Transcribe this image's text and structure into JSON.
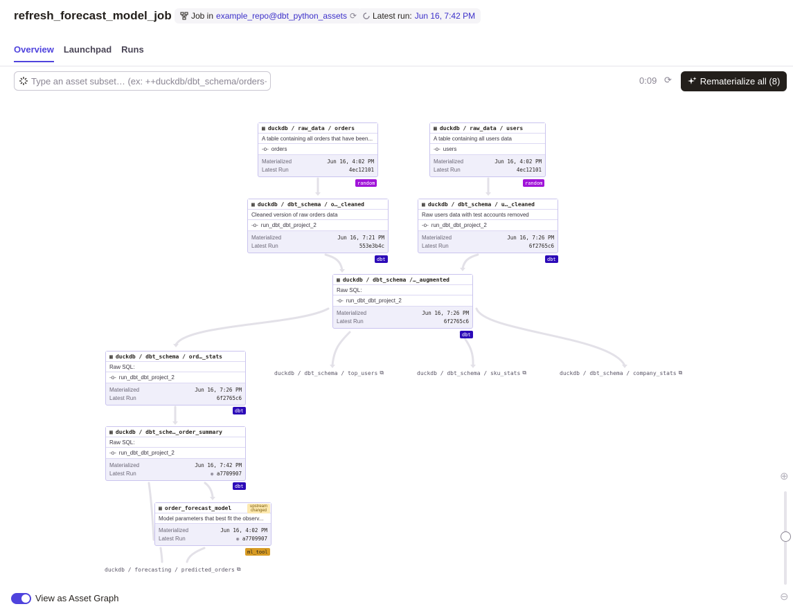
{
  "header": {
    "title": "refresh_forecast_model_job",
    "job_in_label": "Job in",
    "repo": "example_repo@dbt_python_assets",
    "latest_run_label": "Latest run:",
    "latest_run_value": "Jun 16, 7:42 PM"
  },
  "tabs": [
    {
      "label": "Overview",
      "active": true
    },
    {
      "label": "Launchpad",
      "active": false
    },
    {
      "label": "Runs",
      "active": false
    }
  ],
  "toolbar": {
    "search_placeholder": "Type an asset subset… (ex: ++duckdb/dbt_schema/orders+)",
    "timer": "0:09",
    "rematerialize_label": "Rematerialize all (8)"
  },
  "labels": {
    "materialized": "Materialized",
    "latest_run": "Latest Run"
  },
  "nodes": {
    "raw_orders": {
      "title": "duckdb / raw_data / orders",
      "desc": "A table containing all orders that have been...",
      "code": "orders",
      "materialized": "Jun 16, 4:02 PM",
      "latest_run": "4ec12101",
      "kind": "random"
    },
    "raw_users": {
      "title": "duckdb / raw_data / users",
      "desc": "A table containing all users data",
      "code": "users",
      "materialized": "Jun 16, 4:02 PM",
      "latest_run": "4ec12101",
      "kind": "random"
    },
    "orders_cleaned": {
      "title": "duckdb / dbt_schema / o…_cleaned",
      "desc": "Cleaned version of raw orders data",
      "code": "run_dbt_dbt_project_2",
      "materialized": "Jun 16, 7:21 PM",
      "latest_run": "553e3b4c",
      "kind": "dbt"
    },
    "users_cleaned": {
      "title": "duckdb / dbt_schema / u…_cleaned",
      "desc": "Raw users data with test accounts removed",
      "code": "run_dbt_dbt_project_2",
      "materialized": "Jun 16, 7:26 PM",
      "latest_run": "6f2765c6",
      "kind": "dbt"
    },
    "augmented": {
      "title": "duckdb / dbt_schema /…_augmented",
      "desc": "Raw SQL:",
      "code": "run_dbt_dbt_project_2",
      "materialized": "Jun 16, 7:26 PM",
      "latest_run": "6f2765c6",
      "kind": "dbt"
    },
    "order_stats": {
      "title": "duckdb / dbt_schema / ord…_stats",
      "desc": "Raw SQL:",
      "code": "run_dbt_dbt_project_2",
      "materialized": "Jun 16, 7:26 PM",
      "latest_run": "6f2765c6",
      "kind": "dbt"
    },
    "order_summary": {
      "title": "duckdb / dbt_sche…_order_summary",
      "desc": "Raw SQL:",
      "code": "run_dbt_dbt_project_2",
      "materialized": "Jun 16, 7:42 PM",
      "latest_run": "a7709907",
      "kind": "dbt"
    },
    "forecast": {
      "title": "order_forecast_model",
      "desc": "Model parameters that best fit the observ...",
      "badge": "upstream changed",
      "materialized": "Jun 16, 4:02 PM",
      "latest_run": "a7709907",
      "kind": "ml_tool"
    }
  },
  "external_assets": {
    "top_users": "duckdb / dbt_schema / top_users",
    "sku_stats": "duckdb / dbt_schema / sku_stats",
    "company_stats": "duckdb / dbt_schema / company_stats",
    "predicted_orders": "duckdb / forecasting / predicted_orders"
  },
  "view_toggle": {
    "label": "View as Asset Graph",
    "on": true
  }
}
